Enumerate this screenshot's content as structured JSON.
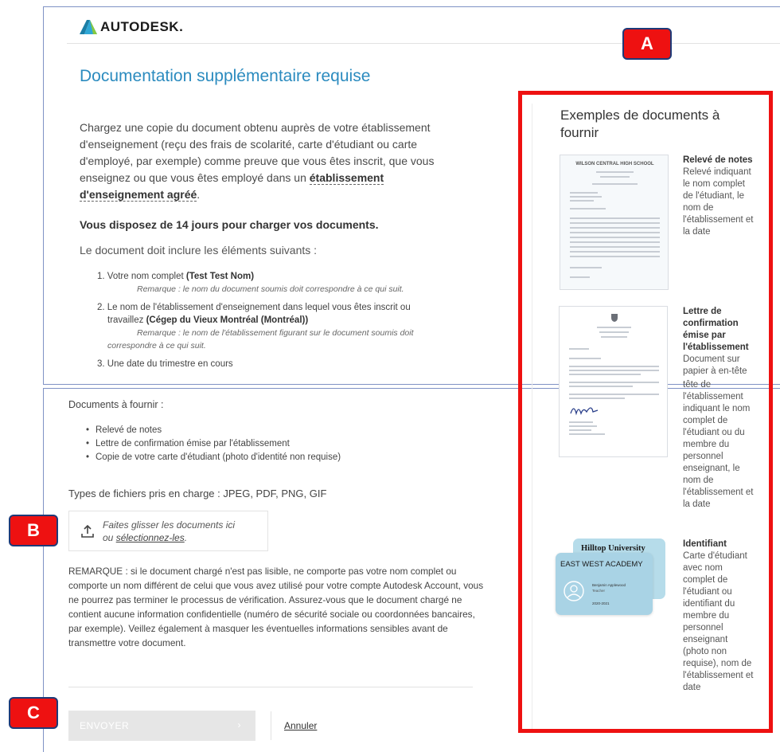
{
  "header": {
    "brand": "AUTODESK."
  },
  "main": {
    "title": "Documentation supplémentaire requise",
    "intro_lines": [
      "Chargez une copie du document obtenu auprès de votre établissement",
      "d'enseignement (reçu des frais de scolarité, carte d'étudiant ou carte",
      "d'employé, par exemple) comme preuve que vous êtes inscrit, que vous",
      "enseignez ou que vous êtes employé dans un"
    ],
    "intro_link_1": "établissement",
    "intro_link_2": "d'enseignement agréé",
    "intro_end": ".",
    "deadline": "Vous disposez de 14 jours pour charger vos documents.",
    "include_label": "Le document doit inclure les éléments suivants :",
    "requirements": [
      {
        "prefix": "1. Votre nom complet ",
        "value": "(Test Test Nom)",
        "note": "Remarque : le nom du document soumis doit correspondre à ce qui suit."
      },
      {
        "prefix": "2. Le nom de l'établissement d'enseignement dans lequel vous êtes inscrit ou",
        "prefix2": "travaillez ",
        "value": "(Cégep du Vieux Montréal (Montréal))",
        "note": "Remarque : le nom de l'établissement figurant sur le document soumis doit",
        "note_cont": "correspondre à ce qui suit."
      },
      {
        "prefix": "3. Une date du trimestre en cours"
      }
    ],
    "docs_label": "Documents à fournir :",
    "docs": [
      "Relevé de notes",
      "Lettre de confirmation émise par l'établissement",
      "Copie de votre carte d'étudiant (photo d'identité non requise)"
    ],
    "filetypes": "Types de fichiers pris en charge : JPEG, PDF, PNG, GIF",
    "dropzone": {
      "text": "Faites glisser les documents ici",
      "prefix": "ou ",
      "link": "sélectionnez-les",
      "suffix": "."
    },
    "remark": "REMARQUE : si le document chargé n'est pas lisible, ne comporte pas votre nom complet ou comporte un nom différent de celui que vous avez utilisé pour votre compte Autodesk Account, vous ne pourrez pas terminer le processus de vérification. Assurez-vous que le document chargé ne contient aucune information confidentielle (numéro de sécurité sociale ou coordonnées bancaires, par exemple). Veillez également à masquer les éventuelles informations sensibles avant de transmettre votre document.",
    "submit_label": "ENVOYER",
    "submit_chevron": "›",
    "cancel_label": "Annuler"
  },
  "sidebar": {
    "title": "Exemples de documents à fournir",
    "examples": [
      {
        "title": "Relevé de notes",
        "description": "Relevé indiquant le nom complet de l'étudiant, le nom de l'établissement et la date",
        "thumb_text": "WILSON CENTRAL HIGH SCHOOL"
      },
      {
        "title": "Lettre de confirmation émise par l'établissement",
        "description_overlap": "Document sur papier à en-tête de",
        "description": "tête de l'établissement indiquant le nom complet de l'étudiant ou du membre du personnel enseignant, le nom de l'établissement et la date"
      },
      {
        "title": "Identifiant",
        "description": "Carte d'étudiant avec nom complet de l'étudiant ou identifiant du membre du personnel enseignant (photo non requise), nom de l'établissement et date",
        "card_back": "Hilltop University",
        "card_front": "EAST WEST ACADEMY",
        "card_name": "Benjamin Applewood",
        "card_role": "Teacher",
        "card_year": "2020-2021"
      }
    ]
  },
  "annotations": {
    "a": "A",
    "b": "B",
    "c": "C"
  },
  "colors": {
    "accent": "#2b8bbf",
    "marker": "#ee1111",
    "frame": "#7f92c5"
  }
}
